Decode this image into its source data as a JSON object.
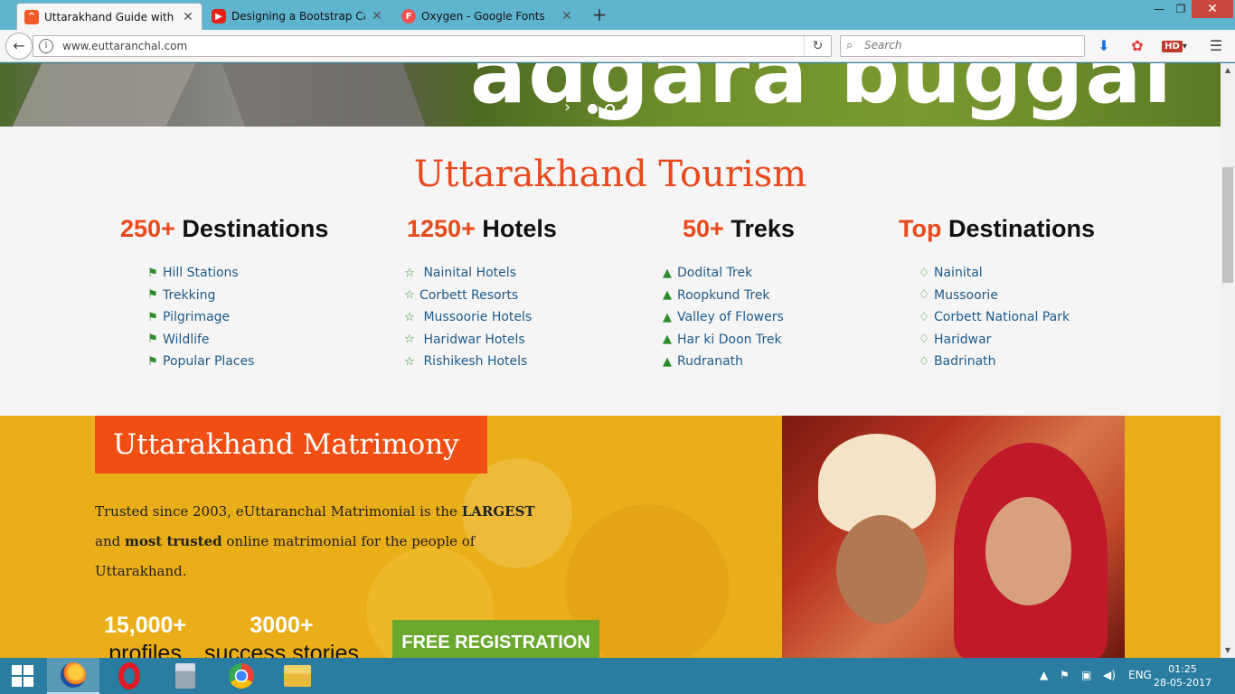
{
  "browser": {
    "tabs": [
      {
        "title": "Uttarakhand Guide with Late",
        "favicon": "uttarakhand-favicon",
        "color": "#f05a28"
      },
      {
        "title": "Designing a Bootstrap Carou",
        "favicon": "youtube-favicon",
        "color": "#e62117"
      },
      {
        "title": "Oxygen - Google Fonts",
        "favicon": "google-fonts-favicon",
        "color": "#ef5350",
        "letter": "F"
      }
    ],
    "url": "www.euttaranchal.com",
    "search_placeholder": "Search",
    "new_tab": "+",
    "hd_badge": "HD"
  },
  "hero": {
    "text": "adgara buggal"
  },
  "tourism": {
    "title": "Uttarakhand Tourism",
    "columns": [
      {
        "highlight": "250+",
        "heading": "Destinations",
        "icon": "flag-icon",
        "items": [
          "Hill Stations",
          "Trekking",
          "Pilgrimage",
          "Wildlife",
          "Popular Places"
        ]
      },
      {
        "highlight": "1250+",
        "heading": "Hotels",
        "icon": "star-outline-icon",
        "items": [
          "Nainital Hotels",
          "Corbett Resorts",
          "Mussoorie Hotels",
          "Haridwar Hotels",
          "Rishikesh Hotels"
        ]
      },
      {
        "highlight": "50+",
        "heading": "Treks",
        "icon": "tree-icon",
        "items": [
          "Dodital Trek",
          "Roopkund Trek",
          "Valley of Flowers",
          "Har ki Doon Trek",
          "Rudranath"
        ]
      },
      {
        "highlight": "Top",
        "heading": "Destinations",
        "icon": "thumbs-up-icon",
        "items": [
          "Nainital",
          "Mussoorie",
          "Corbett National Park",
          "Haridwar",
          "Badrinath"
        ]
      }
    ]
  },
  "matrimony": {
    "title": "Uttarakhand Matrimony",
    "text_1": "Trusted since 2003, eUttaranchal Matrimonial is the ",
    "text_bold_1": "LARGEST",
    "text_2": " and ",
    "text_bold_2": "most trusted",
    "text_3": " online matrimonial for the people of Uttarakhand.",
    "stats": [
      {
        "value": "15,000+",
        "label": "profiles"
      },
      {
        "value": "3000+",
        "label": "success stories"
      }
    ],
    "cta": "FREE REGISTRATION"
  },
  "taskbar": {
    "apps": [
      "firefox",
      "opera",
      "calculator",
      "chrome",
      "file-explorer"
    ],
    "language": "ENG",
    "time": "01:25",
    "date": "28-05-2017"
  },
  "colors": {
    "accent": "#e8491d",
    "link": "#1f5a8a",
    "matrimony_bg": "#eaae18",
    "cta_green": "#6aa92d"
  }
}
